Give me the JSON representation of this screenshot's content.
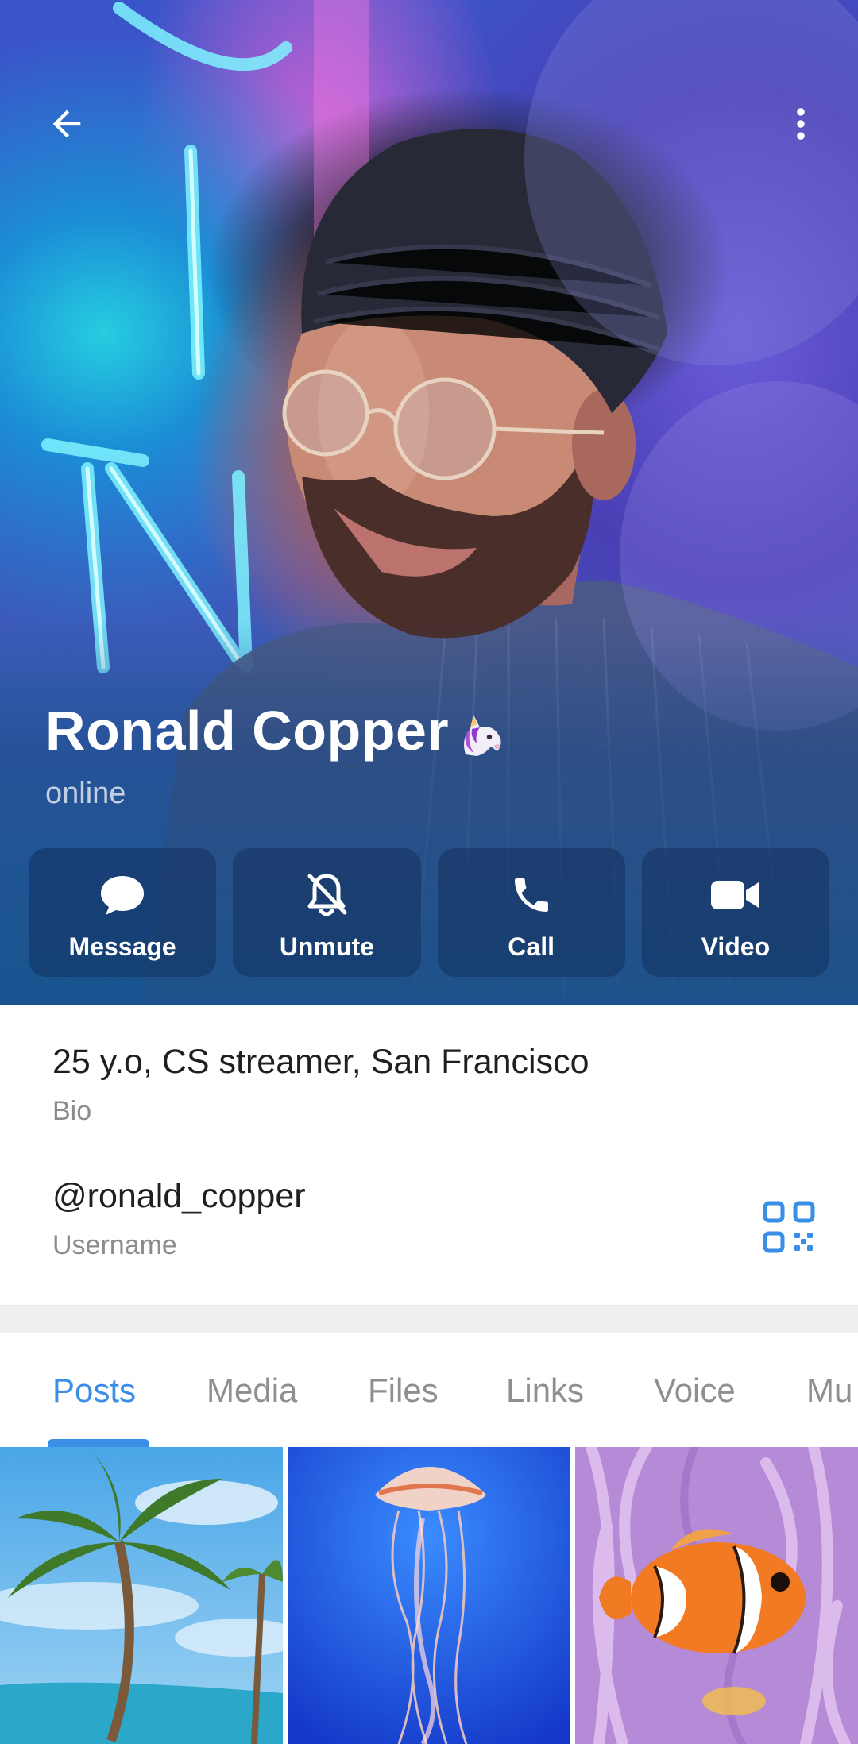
{
  "profile": {
    "name": "Ronald Copper",
    "emoji": "unicorn-emoji",
    "status": "online"
  },
  "actions": [
    {
      "label": "Message",
      "icon": "message-bubble-icon"
    },
    {
      "label": "Unmute",
      "icon": "bell-off-icon"
    },
    {
      "label": "Call",
      "icon": "phone-icon"
    },
    {
      "label": "Video",
      "icon": "video-camera-icon"
    }
  ],
  "info": {
    "bio_value": "25 y.o, CS streamer, San Francisco",
    "bio_label": "Bio",
    "username_value": "@ronald_copper",
    "username_label": "Username"
  },
  "tabs": [
    {
      "label": "Posts",
      "active": true
    },
    {
      "label": "Media",
      "active": false
    },
    {
      "label": "Files",
      "active": false
    },
    {
      "label": "Links",
      "active": false
    },
    {
      "label": "Voice",
      "active": false
    },
    {
      "label": "Mu",
      "active": false
    }
  ],
  "media": [
    {
      "subject": "palm-tree-beach-photo"
    },
    {
      "subject": "jellyfish-photo"
    },
    {
      "subject": "clownfish-photo"
    }
  ],
  "colors": {
    "accent": "#3a8ee6",
    "action_button_bg": "rgba(14,38,78,0.42)",
    "secondary_text": "#8c8c8c"
  }
}
